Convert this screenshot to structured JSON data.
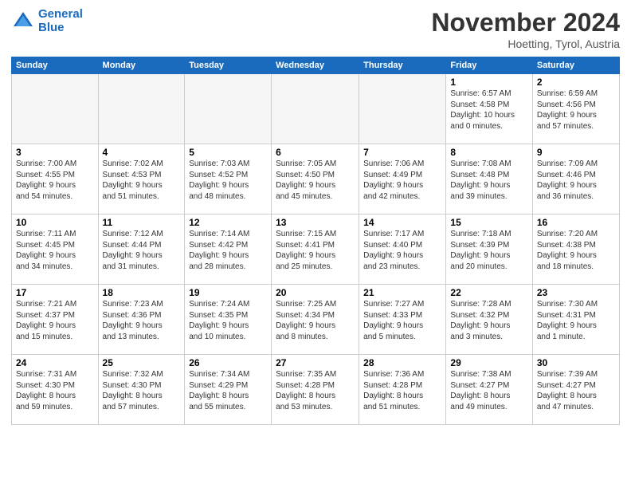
{
  "logo": {
    "line1": "General",
    "line2": "Blue"
  },
  "title": "November 2024",
  "location": "Hoetting, Tyrol, Austria",
  "days_of_week": [
    "Sunday",
    "Monday",
    "Tuesday",
    "Wednesday",
    "Thursday",
    "Friday",
    "Saturday"
  ],
  "weeks": [
    [
      {
        "day": "",
        "info": "",
        "empty": true
      },
      {
        "day": "",
        "info": "",
        "empty": true
      },
      {
        "day": "",
        "info": "",
        "empty": true
      },
      {
        "day": "",
        "info": "",
        "empty": true
      },
      {
        "day": "",
        "info": "",
        "empty": true
      },
      {
        "day": "1",
        "info": "Sunrise: 6:57 AM\nSunset: 4:58 PM\nDaylight: 10 hours\nand 0 minutes.",
        "empty": false
      },
      {
        "day": "2",
        "info": "Sunrise: 6:59 AM\nSunset: 4:56 PM\nDaylight: 9 hours\nand 57 minutes.",
        "empty": false
      }
    ],
    [
      {
        "day": "3",
        "info": "Sunrise: 7:00 AM\nSunset: 4:55 PM\nDaylight: 9 hours\nand 54 minutes.",
        "empty": false
      },
      {
        "day": "4",
        "info": "Sunrise: 7:02 AM\nSunset: 4:53 PM\nDaylight: 9 hours\nand 51 minutes.",
        "empty": false
      },
      {
        "day": "5",
        "info": "Sunrise: 7:03 AM\nSunset: 4:52 PM\nDaylight: 9 hours\nand 48 minutes.",
        "empty": false
      },
      {
        "day": "6",
        "info": "Sunrise: 7:05 AM\nSunset: 4:50 PM\nDaylight: 9 hours\nand 45 minutes.",
        "empty": false
      },
      {
        "day": "7",
        "info": "Sunrise: 7:06 AM\nSunset: 4:49 PM\nDaylight: 9 hours\nand 42 minutes.",
        "empty": false
      },
      {
        "day": "8",
        "info": "Sunrise: 7:08 AM\nSunset: 4:48 PM\nDaylight: 9 hours\nand 39 minutes.",
        "empty": false
      },
      {
        "day": "9",
        "info": "Sunrise: 7:09 AM\nSunset: 4:46 PM\nDaylight: 9 hours\nand 36 minutes.",
        "empty": false
      }
    ],
    [
      {
        "day": "10",
        "info": "Sunrise: 7:11 AM\nSunset: 4:45 PM\nDaylight: 9 hours\nand 34 minutes.",
        "empty": false
      },
      {
        "day": "11",
        "info": "Sunrise: 7:12 AM\nSunset: 4:44 PM\nDaylight: 9 hours\nand 31 minutes.",
        "empty": false
      },
      {
        "day": "12",
        "info": "Sunrise: 7:14 AM\nSunset: 4:42 PM\nDaylight: 9 hours\nand 28 minutes.",
        "empty": false
      },
      {
        "day": "13",
        "info": "Sunrise: 7:15 AM\nSunset: 4:41 PM\nDaylight: 9 hours\nand 25 minutes.",
        "empty": false
      },
      {
        "day": "14",
        "info": "Sunrise: 7:17 AM\nSunset: 4:40 PM\nDaylight: 9 hours\nand 23 minutes.",
        "empty": false
      },
      {
        "day": "15",
        "info": "Sunrise: 7:18 AM\nSunset: 4:39 PM\nDaylight: 9 hours\nand 20 minutes.",
        "empty": false
      },
      {
        "day": "16",
        "info": "Sunrise: 7:20 AM\nSunset: 4:38 PM\nDaylight: 9 hours\nand 18 minutes.",
        "empty": false
      }
    ],
    [
      {
        "day": "17",
        "info": "Sunrise: 7:21 AM\nSunset: 4:37 PM\nDaylight: 9 hours\nand 15 minutes.",
        "empty": false
      },
      {
        "day": "18",
        "info": "Sunrise: 7:23 AM\nSunset: 4:36 PM\nDaylight: 9 hours\nand 13 minutes.",
        "empty": false
      },
      {
        "day": "19",
        "info": "Sunrise: 7:24 AM\nSunset: 4:35 PM\nDaylight: 9 hours\nand 10 minutes.",
        "empty": false
      },
      {
        "day": "20",
        "info": "Sunrise: 7:25 AM\nSunset: 4:34 PM\nDaylight: 9 hours\nand 8 minutes.",
        "empty": false
      },
      {
        "day": "21",
        "info": "Sunrise: 7:27 AM\nSunset: 4:33 PM\nDaylight: 9 hours\nand 5 minutes.",
        "empty": false
      },
      {
        "day": "22",
        "info": "Sunrise: 7:28 AM\nSunset: 4:32 PM\nDaylight: 9 hours\nand 3 minutes.",
        "empty": false
      },
      {
        "day": "23",
        "info": "Sunrise: 7:30 AM\nSunset: 4:31 PM\nDaylight: 9 hours\nand 1 minute.",
        "empty": false
      }
    ],
    [
      {
        "day": "24",
        "info": "Sunrise: 7:31 AM\nSunset: 4:30 PM\nDaylight: 8 hours\nand 59 minutes.",
        "empty": false
      },
      {
        "day": "25",
        "info": "Sunrise: 7:32 AM\nSunset: 4:30 PM\nDaylight: 8 hours\nand 57 minutes.",
        "empty": false
      },
      {
        "day": "26",
        "info": "Sunrise: 7:34 AM\nSunset: 4:29 PM\nDaylight: 8 hours\nand 55 minutes.",
        "empty": false
      },
      {
        "day": "27",
        "info": "Sunrise: 7:35 AM\nSunset: 4:28 PM\nDaylight: 8 hours\nand 53 minutes.",
        "empty": false
      },
      {
        "day": "28",
        "info": "Sunrise: 7:36 AM\nSunset: 4:28 PM\nDaylight: 8 hours\nand 51 minutes.",
        "empty": false
      },
      {
        "day": "29",
        "info": "Sunrise: 7:38 AM\nSunset: 4:27 PM\nDaylight: 8 hours\nand 49 minutes.",
        "empty": false
      },
      {
        "day": "30",
        "info": "Sunrise: 7:39 AM\nSunset: 4:27 PM\nDaylight: 8 hours\nand 47 minutes.",
        "empty": false
      }
    ]
  ]
}
